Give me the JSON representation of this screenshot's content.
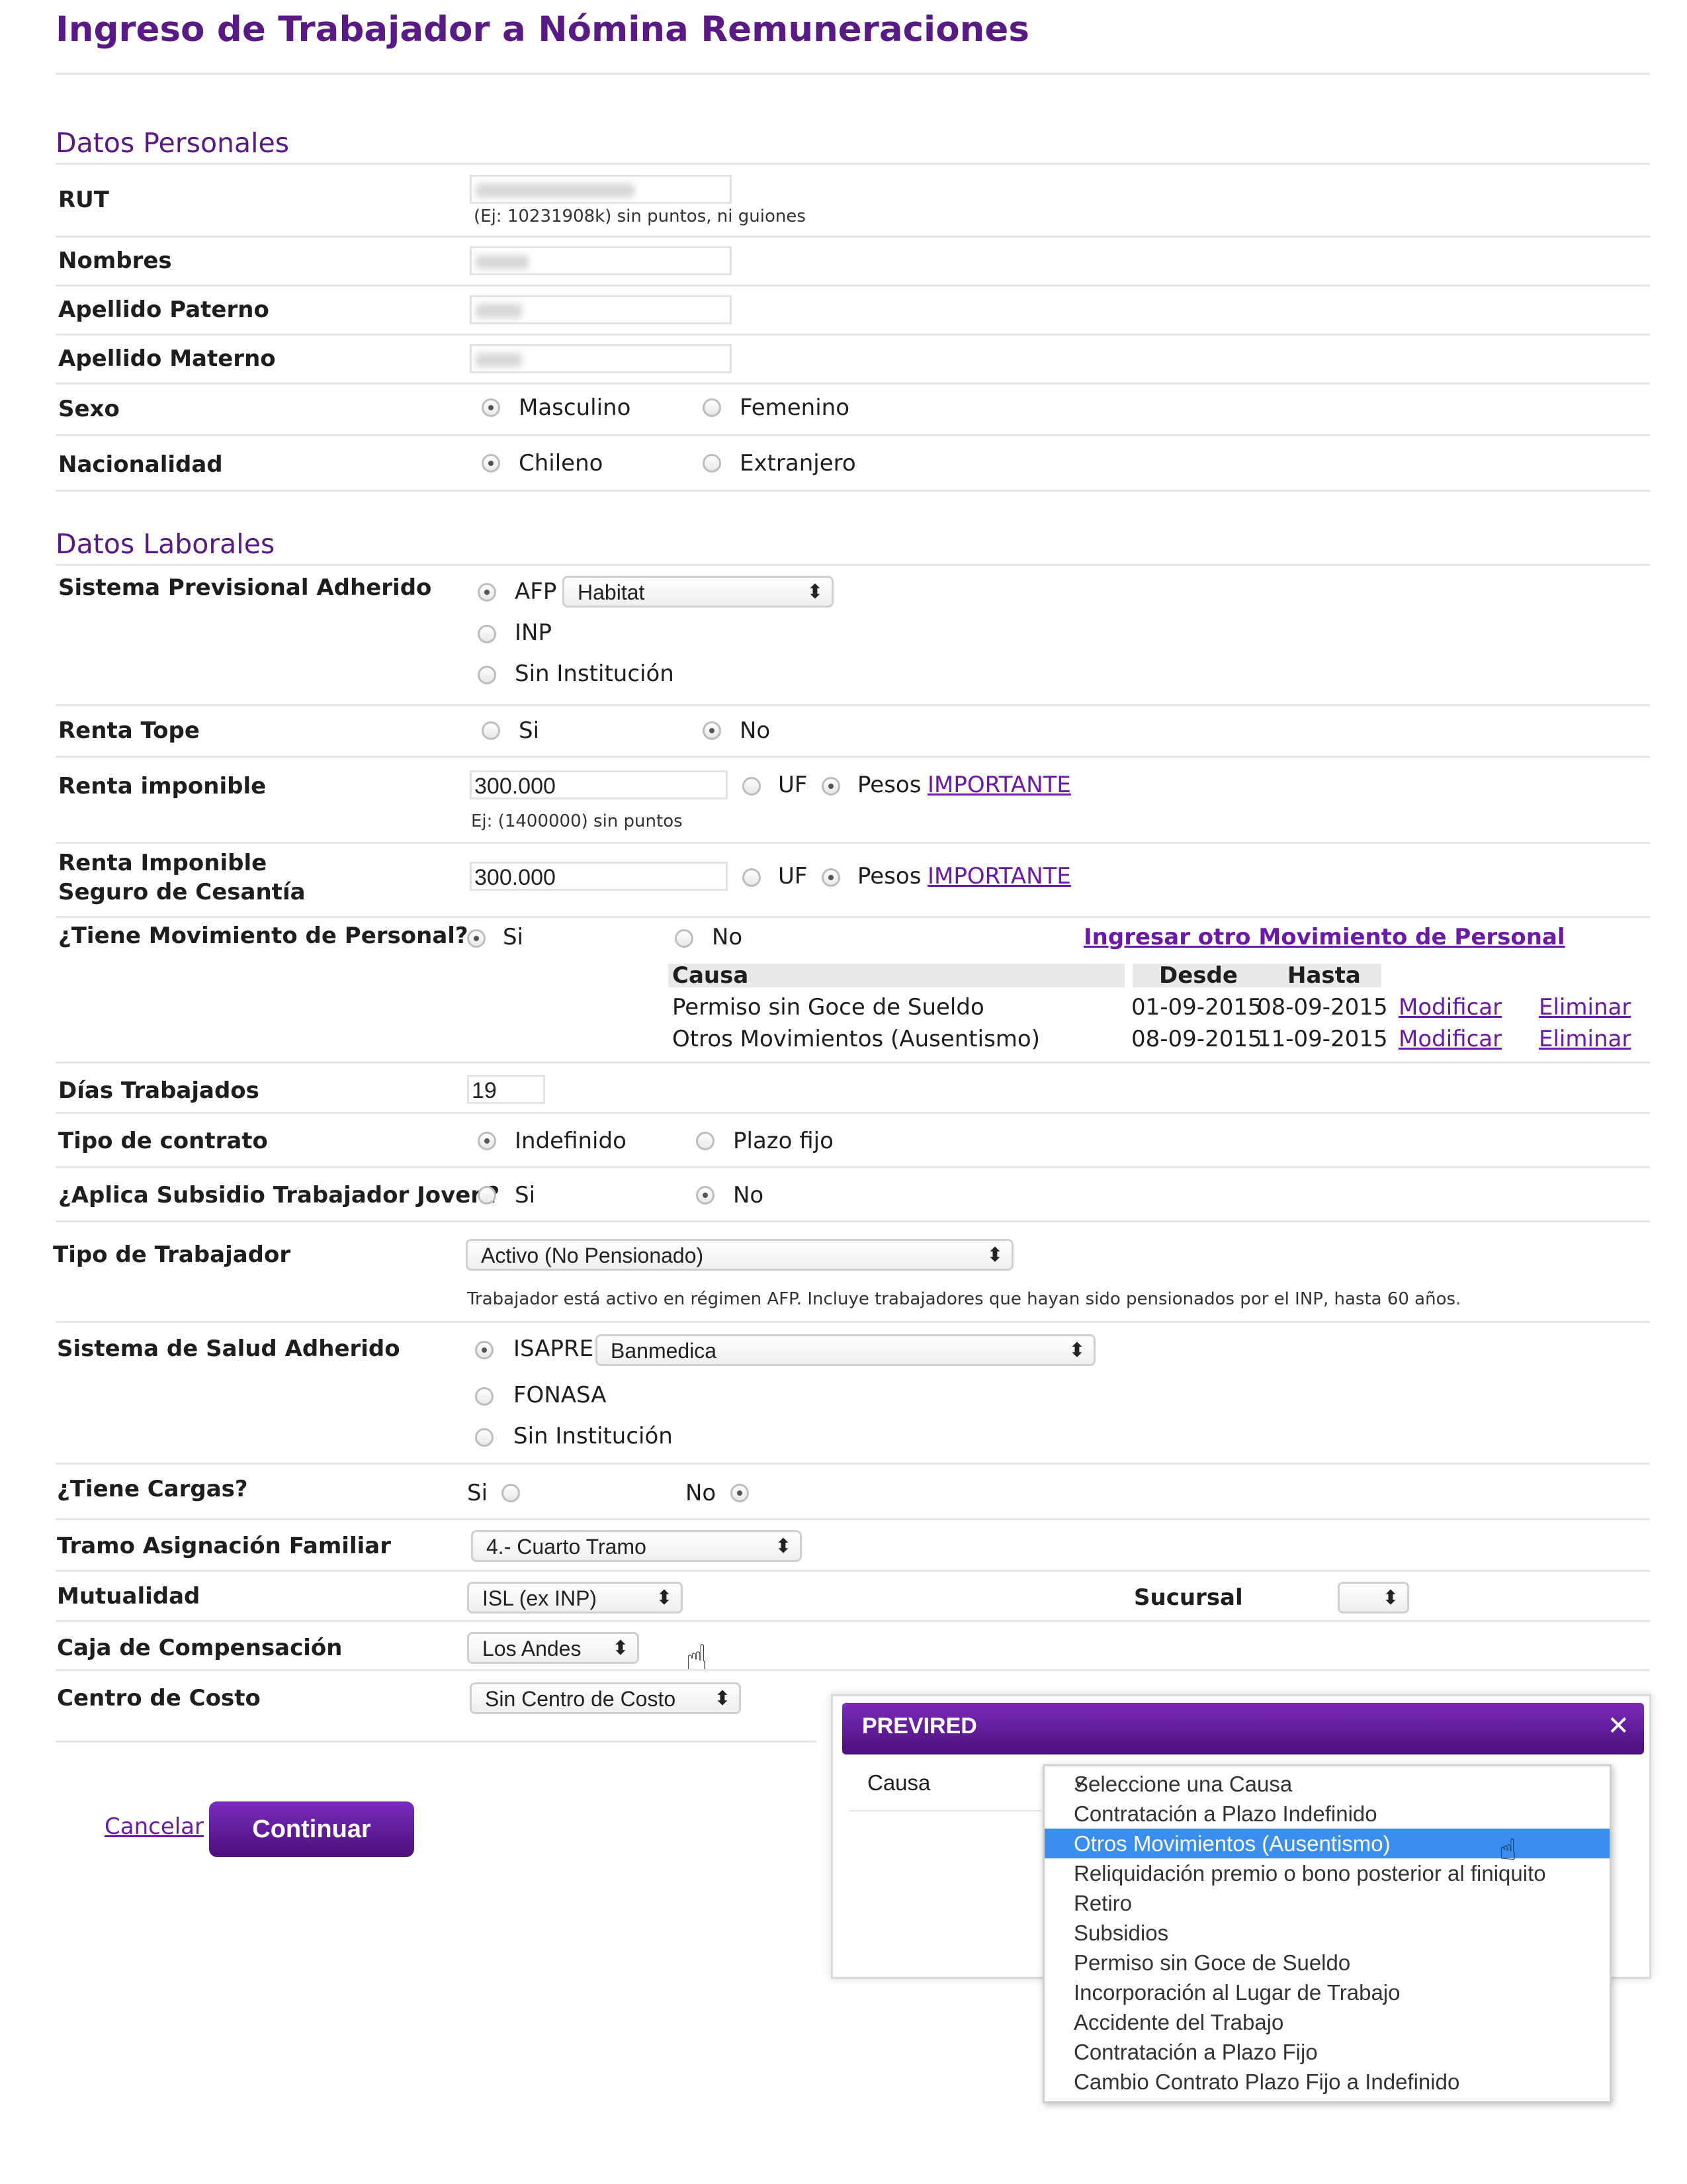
{
  "page": {
    "title": "Ingreso de Trabajador a Nómina Remuneraciones"
  },
  "personal": {
    "heading": "Datos Personales",
    "rut": {
      "label": "RUT",
      "hint": "(Ej: 10231908k) sin puntos, ni guiones"
    },
    "nombres": {
      "label": "Nombres"
    },
    "apellido_paterno": {
      "label": "Apellido Paterno"
    },
    "apellido_materno": {
      "label": "Apellido Materno"
    },
    "sexo": {
      "label": "Sexo",
      "options": [
        "Masculino",
        "Femenino"
      ],
      "selected": "Masculino"
    },
    "nacionalidad": {
      "label": "Nacionalidad",
      "options": [
        "Chileno",
        "Extranjero"
      ],
      "selected": "Chileno"
    }
  },
  "laboral": {
    "heading": "Datos Laborales",
    "sistema_previsional": {
      "label": "Sistema Previsional Adherido",
      "options": [
        "AFP",
        "INP",
        "Sin Institución"
      ],
      "selected": "AFP",
      "afp_value": "Habitat"
    },
    "renta_tope": {
      "label": "Renta Tope",
      "options": [
        "Si",
        "No"
      ],
      "selected": "No"
    },
    "renta_imponible": {
      "label": "Renta imponible",
      "value": "300.000",
      "hint": "Ej: (1400000) sin puntos",
      "unit_options": [
        "UF",
        "Pesos"
      ],
      "unit_selected": "Pesos",
      "link": "IMPORTANTE"
    },
    "renta_cesantia": {
      "label_line1": "Renta Imponible",
      "label_line2": "Seguro de Cesantía",
      "value": "300.000",
      "unit_options": [
        "UF",
        "Pesos"
      ],
      "unit_selected": "Pesos",
      "link": "IMPORTANTE"
    },
    "movimiento": {
      "label": "¿Tiene Movimiento de Personal?",
      "options": [
        "Si",
        "No"
      ],
      "selected": "Si",
      "add_link": "Ingresar otro Movimiento de Personal",
      "columns": [
        "Causa",
        "Desde",
        "Hasta"
      ],
      "rows": [
        {
          "causa": "Permiso sin Goce de Sueldo",
          "desde": "01-09-2015",
          "hasta": "08-09-2015",
          "modificar": "Modificar",
          "eliminar": "Eliminar"
        },
        {
          "causa": "Otros Movimientos (Ausentismo)",
          "desde": "08-09-2015",
          "hasta": "11-09-2015",
          "modificar": "Modificar",
          "eliminar": "Eliminar"
        }
      ]
    },
    "dias_trabajados": {
      "label": "Días Trabajados",
      "value": "19"
    },
    "tipo_contrato": {
      "label": "Tipo de contrato",
      "options": [
        "Indefinido",
        "Plazo fijo"
      ],
      "selected": "Indefinido"
    },
    "subsidio_joven": {
      "label": "¿Aplica Subsidio Trabajador Joven?",
      "options": [
        "Si",
        "No"
      ],
      "selected": "No"
    },
    "tipo_trabajador": {
      "label": "Tipo de Trabajador",
      "value": "Activo (No Pensionado)",
      "hint": "Trabajador está activo en régimen AFP. Incluye trabajadores que hayan sido pensionados por el INP, hasta 60 años."
    },
    "salud": {
      "label": "Sistema de Salud Adherido",
      "options": [
        "ISAPRE",
        "FONASA",
        "Sin Institución"
      ],
      "selected": "ISAPRE",
      "isapre_value": "Banmedica"
    },
    "cargas": {
      "label": "¿Tiene Cargas?",
      "options": [
        "Si",
        "No"
      ],
      "selected": "No"
    },
    "tramo": {
      "label": "Tramo Asignación Familiar",
      "value": "4.- Cuarto Tramo"
    },
    "mutualidad": {
      "label": "Mutualidad",
      "value": "ISL (ex INP)",
      "sucursal_label": "Sucursal",
      "sucursal_value": ""
    },
    "caja": {
      "label": "Caja de Compensación",
      "value": "Los Andes"
    },
    "centro_costo": {
      "label": "Centro de Costo",
      "value": "Sin Centro de Costo"
    }
  },
  "actions": {
    "cancel": "Cancelar",
    "continue": "Continuar"
  },
  "modal": {
    "title": "PREVIRED",
    "close": "×",
    "field_label": "Causa",
    "options": [
      "Seleccione una Causa",
      "Contratación a Plazo Indefinido",
      "Otros Movimientos (Ausentismo)",
      "Reliquidación premio o bono posterior al finiquito",
      "Retiro",
      "Subsidios",
      "Permiso sin Goce de Sueldo",
      "Incorporación al Lugar de Trabajo",
      "Accidente del Trabajo",
      "Contratación a Plazo Fijo",
      "Cambio Contrato Plazo Fijo a Indefinido"
    ],
    "checked": "Seleccione una Causa",
    "highlighted": "Otros Movimientos (Ausentismo)"
  },
  "icons": {
    "select_arrow": "updown-arrow-icon",
    "cursor": "hand-pointer-icon",
    "close": "close-icon"
  },
  "colors": {
    "brand_purple": "#5a1a86",
    "button_purple": "#6a1fa8",
    "highlight_blue": "#3a8ef0"
  }
}
